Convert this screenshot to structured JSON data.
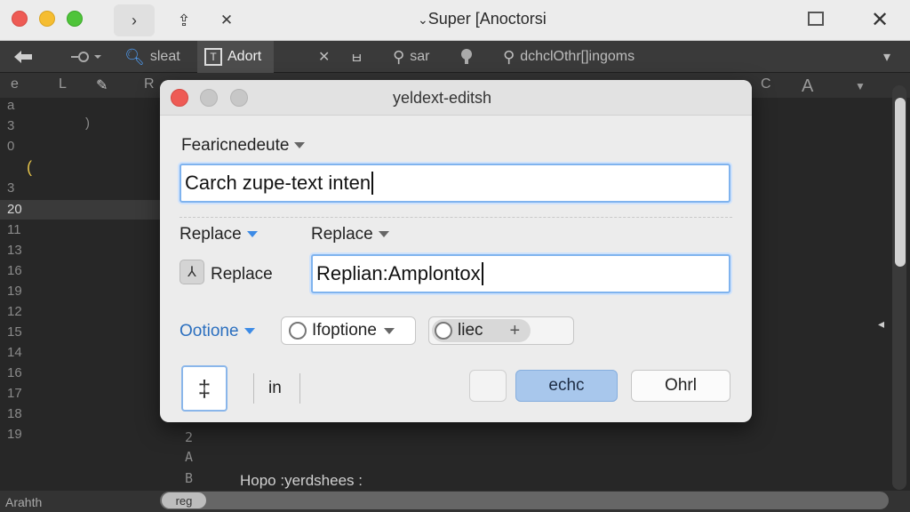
{
  "window": {
    "title": "Super [Anoctorsi",
    "back_glyph": "›",
    "share_glyph": "⇪",
    "close_glyph": "✕"
  },
  "toolbar": {
    "items": [
      "sleat",
      "Adort",
      "sar",
      "dchclOthr[]ingoms"
    ],
    "close_glyph": "✕"
  },
  "subbar": [
    "e",
    "L",
    "R",
    "C",
    "A"
  ],
  "gutter": {
    "lines": [
      "a",
      "3",
      "0",
      "(",
      "3",
      "20",
      "11",
      "13",
      "16",
      "19",
      "12",
      "15",
      "14",
      "16",
      "17",
      "18",
      "19"
    ],
    "extra": [
      "2",
      "A",
      "B"
    ]
  },
  "editor": {
    "code_line": "Hopo :yerdshees :",
    "status": "Arahth",
    "hscroll_label": "reg"
  },
  "dialog": {
    "title": "yeldext-editsh",
    "find_label": "Fearicnedeute",
    "find_value": "Carch zupe-text inten",
    "replace_mode_label": "Replace",
    "replace_dropdown_label": "Replace",
    "replace_toggle_label": "Replace",
    "replace_value": "Replian:Amplontox",
    "options_label": "Ootione",
    "option_select_label": "Ifoptione",
    "option_chip_label": "liec",
    "option_chip_plus": "+",
    "big_button_glyph": "‡",
    "in_label": "in",
    "primary_button": "echc",
    "secondary_button": "Ohrl"
  }
}
